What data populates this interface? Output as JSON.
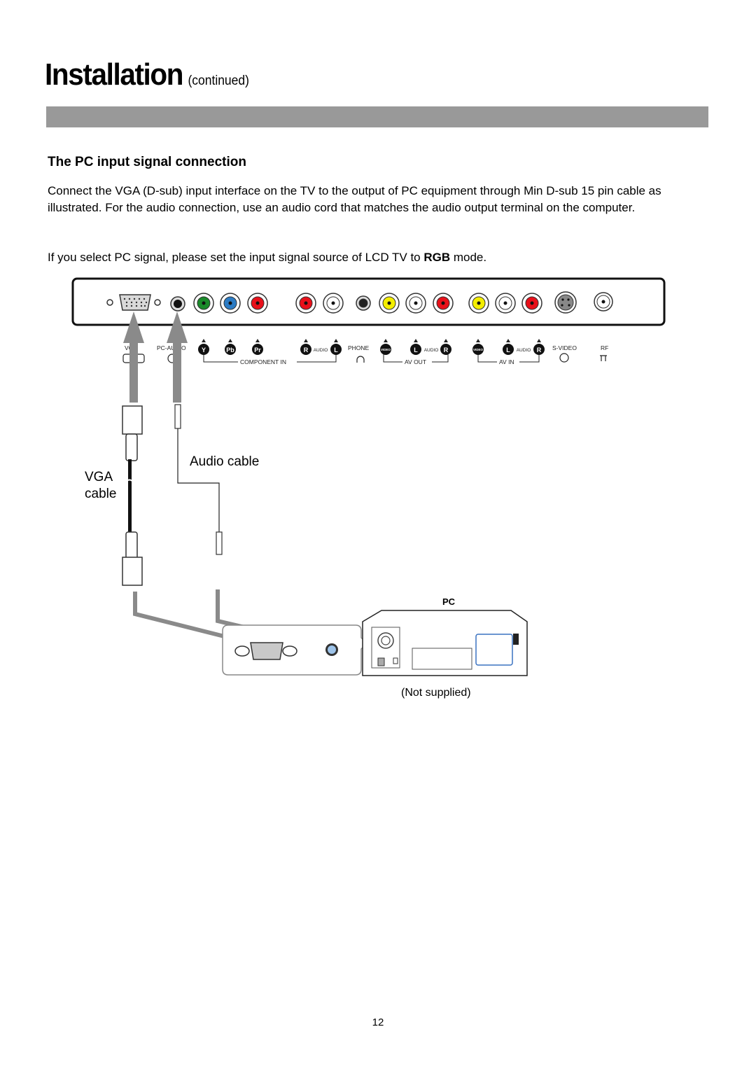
{
  "page": {
    "title": "Installation",
    "title_suffix": "(continued)",
    "section_heading": "The PC input signal connection",
    "paragraph_1": "Connect the VGA (D-sub) input interface on the TV to the output of PC equipment through Min D-sub 15 pin cable as illustrated. For the audio connection, use an audio cord that matches the audio output terminal on the computer.",
    "paragraph_2_prefix": "If you select PC signal, please set the input signal source of LCD TV to ",
    "paragraph_2_bold": "RGB",
    "paragraph_2_suffix": " mode.",
    "page_number": "12"
  },
  "diagram": {
    "panel_labels": {
      "vga": "VGA",
      "pc_audio": "PC-AUDIO",
      "y": "Y",
      "pb": "Pb",
      "pr": "Pr",
      "r": "R",
      "l": "L",
      "audio": "AUDIO",
      "phone": "PHONE",
      "video": "VIDEO",
      "component_in": "COMPONENT IN",
      "av_out": "AV OUT",
      "av_in": "AV IN",
      "s_video": "S-VIDEO",
      "rf": "RF"
    },
    "connector_colors": {
      "green": "#1a8a2a",
      "blue": "#2b7bc4",
      "red": "#e8101a",
      "white": "#ffffff",
      "yellow": "#f4ee00",
      "black": "#222222"
    },
    "audio_cable_label": "Audio cable",
    "vga_cable_label_1": "VGA",
    "vga_cable_label_2": "cable",
    "pc_label": "PC",
    "not_supplied_label": "(Not supplied)"
  }
}
